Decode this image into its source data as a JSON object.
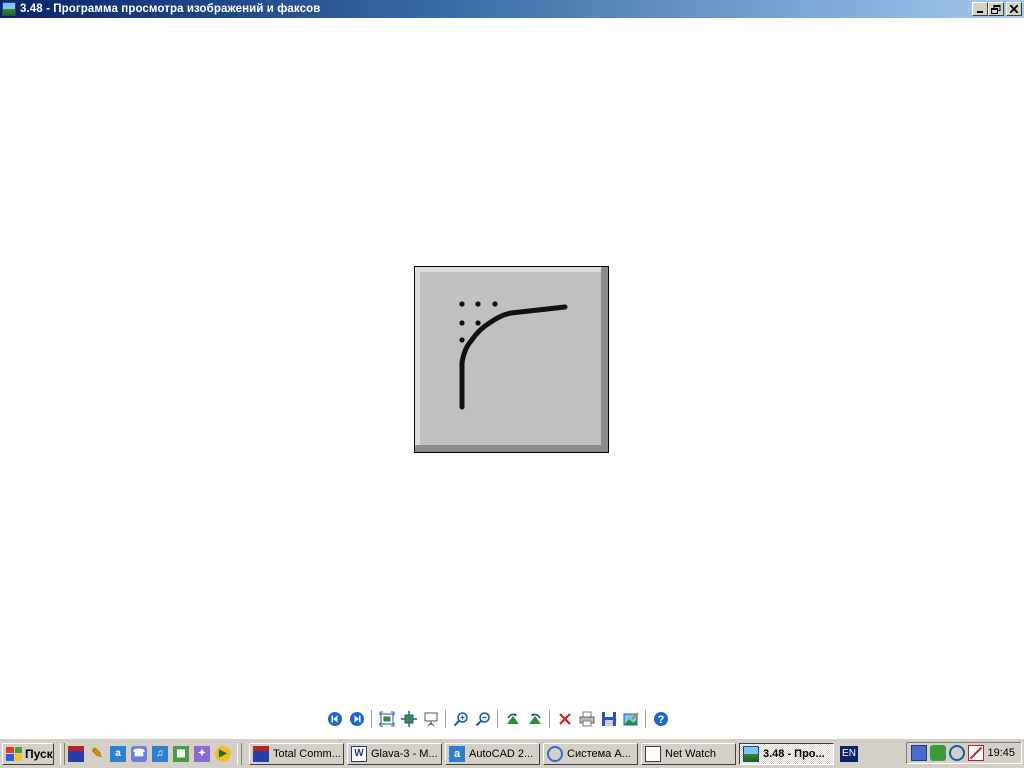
{
  "window": {
    "title": "3.48 - Программа просмотра изображений и факсов",
    "controls": [
      "minimize",
      "restore",
      "close"
    ]
  },
  "image_view": {
    "description_icon": "fillet-corner-icon"
  },
  "viewer_toolbar": {
    "buttons": [
      {
        "name": "previous-image-icon"
      },
      {
        "name": "next-image-icon"
      },
      {
        "name": "best-fit-icon"
      },
      {
        "name": "actual-size-icon"
      },
      {
        "name": "slideshow-icon"
      },
      {
        "name": "zoom-in-icon"
      },
      {
        "name": "zoom-out-icon"
      },
      {
        "name": "rotate-clockwise-icon"
      },
      {
        "name": "rotate-counterclockwise-icon"
      },
      {
        "name": "delete-icon"
      },
      {
        "name": "print-icon"
      },
      {
        "name": "save-icon"
      },
      {
        "name": "edit-icon"
      },
      {
        "name": "help-icon"
      }
    ]
  },
  "taskbar": {
    "start_label": "Пуск",
    "quick_launch": [
      "floppy-save-icon",
      "pencil-icon",
      "letter-a-icon",
      "phone-icon",
      "music-icon",
      "media-icon",
      "tools-icon",
      "player-icon"
    ],
    "tasks": [
      {
        "label": "Total Comm...",
        "icon": "floppy-icon",
        "active": false
      },
      {
        "label": "Glava-3 - M...",
        "icon": "word-icon",
        "active": false
      },
      {
        "label": "AutoCAD 2...",
        "icon": "autocad-icon",
        "active": false
      },
      {
        "label": "Система А...",
        "icon": "browser-icon",
        "active": false
      },
      {
        "label": "Net Watch",
        "icon": "netwatch-icon",
        "active": false
      },
      {
        "label": "3.48 - Про...",
        "icon": "image-viewer-icon",
        "active": true
      }
    ],
    "language": "EN",
    "clock": "19:45"
  }
}
